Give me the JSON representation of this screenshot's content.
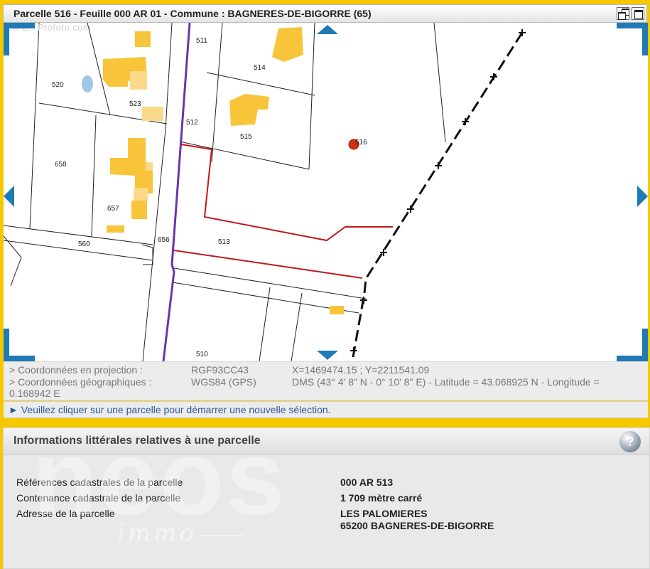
{
  "window": {
    "title": "Parcelle 516 - Feuille 000 AR 01 - Commune : BAGNERES-DE-BIGORRE (65)",
    "restore_icon": "restore-window-icon",
    "maximize_icon": "maximize-window-icon"
  },
  "map": {
    "watermark": "© E...Profoto.com",
    "parcel_labels": [
      {
        "id": "511",
        "text": "511"
      },
      {
        "id": "514",
        "text": "514"
      },
      {
        "id": "520",
        "text": "520"
      },
      {
        "id": "523",
        "text": "523"
      },
      {
        "id": "512",
        "text": "512"
      },
      {
        "id": "515",
        "text": "515"
      },
      {
        "id": "516",
        "text": "516"
      },
      {
        "id": "658",
        "text": "658"
      },
      {
        "id": "657",
        "text": "657"
      },
      {
        "id": "560",
        "text": "560"
      },
      {
        "id": "656",
        "text": "656"
      },
      {
        "id": "513",
        "text": "513"
      },
      {
        "id": "510",
        "text": "510"
      }
    ],
    "colors": {
      "building": "#f8c43a",
      "building_light": "#fbd98a",
      "road_purple": "#6a35a8",
      "selection_red": "#c01818",
      "boundary_black": "#111111",
      "nav_blue": "#1f7ab8",
      "water": "#9fc7e8"
    },
    "nav_icons": [
      "pan-up-icon",
      "pan-down-icon",
      "pan-left-icon",
      "pan-right-icon"
    ]
  },
  "coords": {
    "projection_label": "> Coordonnées en projection :",
    "projection_system": "RGF93CC43",
    "projection_value": "X=1469474.15 ; Y=2211541.09",
    "geo_label": "> Coordonnées géographiques :",
    "geo_system": "WGS84 (GPS)",
    "geo_value_line1": "DMS (43° 4' 8\" N - 0° 10' 8\" E) - Latitude = 43.068925 N - Longitude =",
    "geo_value_line2": "0.168942 E"
  },
  "info_bar": {
    "text": "► Veuillez cliquer sur une parcelle pour démarrer une nouvelle sélection."
  },
  "info_panel": {
    "title": "Informations littérales relatives à une parcelle",
    "help_symbol": "?",
    "rows": [
      {
        "label": "Références cadastrales de la parcelle",
        "value": "000 AR 513"
      },
      {
        "label": "Contenance cadastrale de la parcelle",
        "value": "1 709 mètre carré"
      },
      {
        "label": "Adresse de la parcelle",
        "value": "LES PALOMIERES",
        "value2": "65200 BAGNERES-DE-BIGORRE"
      }
    ],
    "watermark_logo": "neos",
    "watermark_sub": "immo"
  }
}
